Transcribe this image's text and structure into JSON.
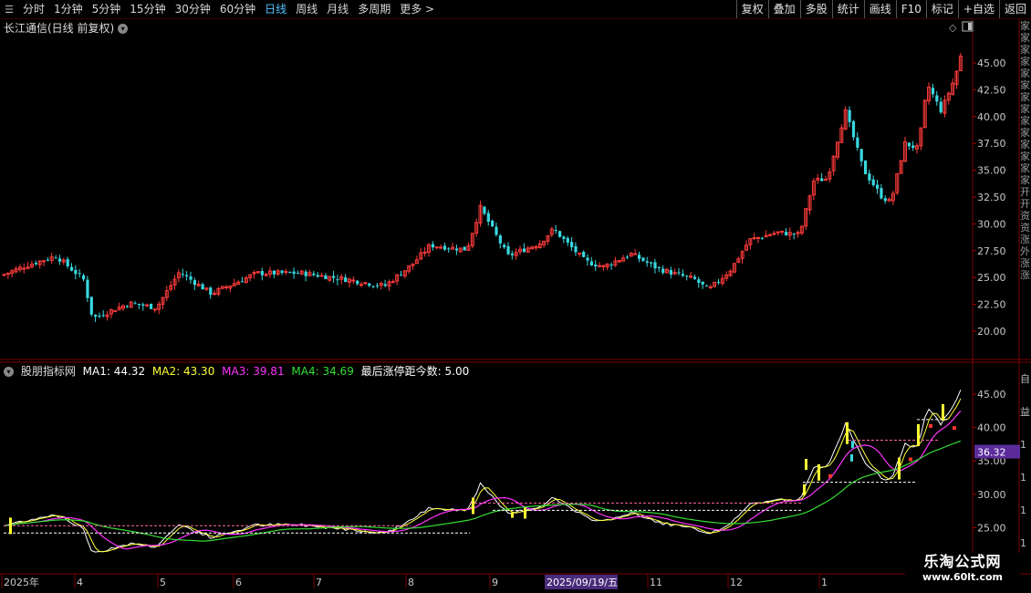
{
  "toolbar": {
    "left_icon": "☰",
    "period_tabs": [
      "分时",
      "1分钟",
      "5分钟",
      "15分钟",
      "30分钟",
      "60分钟",
      "日线",
      "周线",
      "月线",
      "多周期",
      "更多 >"
    ],
    "active_tab": "日线",
    "right_buttons": [
      "复权",
      "叠加",
      "多股",
      "统计",
      "画线",
      "F10",
      "标记",
      "+自选",
      "返回"
    ]
  },
  "main_chart": {
    "title": "长江通信(日线 前复权)",
    "price_axis": [
      "45.00",
      "42.50",
      "40.00",
      "37.50",
      "35.00",
      "32.50",
      "30.00",
      "27.50",
      "25.00",
      "22.50",
      "20.00"
    ]
  },
  "indicator": {
    "name": "股朋指标网",
    "ma1_label": "MA1: 44.32",
    "ma2_label": "MA2: 43.30",
    "ma3_label": "MA3: 39.81",
    "ma4_label": "MA4: 34.69",
    "extra_label": "最后涨停距今数: 5.00",
    "axis": [
      "45.00",
      "40.00",
      "35.00",
      "30.00",
      "25.00"
    ],
    "current_value": "36.32"
  },
  "time_axis": {
    "labels": [
      "2025年",
      "4",
      "5",
      "6",
      "7",
      "8",
      "9",
      "11",
      "12",
      "1"
    ],
    "highlight": "2025/09/19/五"
  },
  "side_text": {
    "upper": "家家家家家家家家家家家家家家开开资资涨外涨涨",
    "lower": "自益1111"
  },
  "watermark": {
    "line1": "乐淘公式网",
    "line2": "www.60lt.com"
  },
  "colors": {
    "up": "#ff3b3b",
    "down": "#38d8e0",
    "ma1": "#ffffff",
    "ma2": "#ffff33",
    "ma3": "#ff33ff",
    "ma4": "#33dd33",
    "grid": "#7a0000",
    "axis_text": "#c8c8c8"
  }
}
